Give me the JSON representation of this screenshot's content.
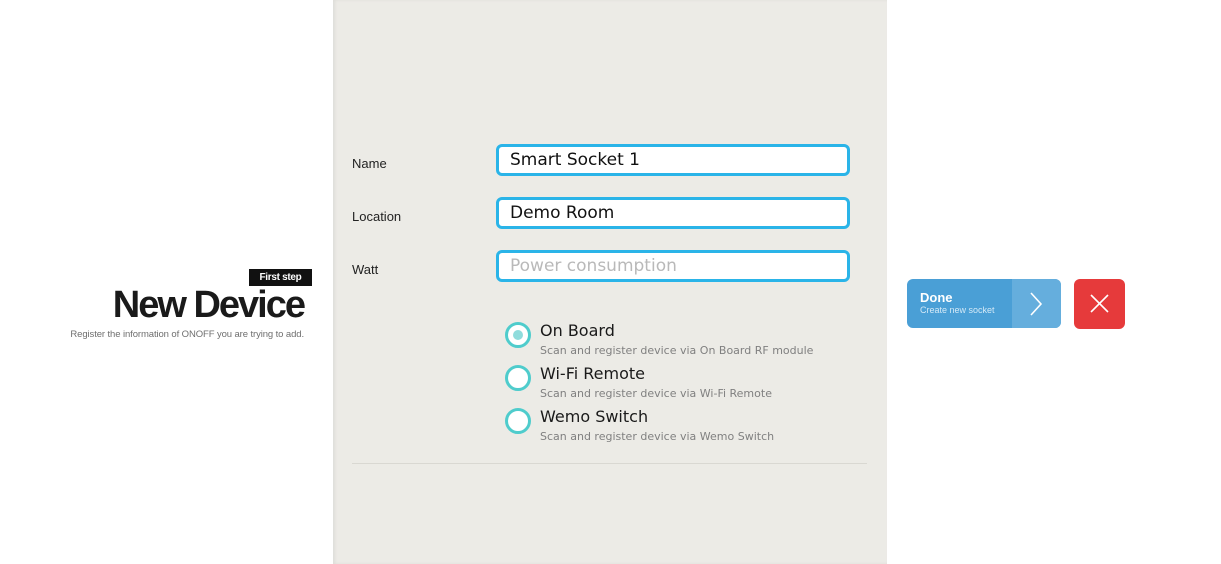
{
  "header": {
    "step_badge": "First step",
    "title": "New Device",
    "subtitle": "Register the information of ONOFF you are trying to add."
  },
  "form": {
    "fields": [
      {
        "label": "Name",
        "value": "Smart Socket 1",
        "placeholder": ""
      },
      {
        "label": "Location",
        "value": "Demo Room",
        "placeholder": ""
      },
      {
        "label": "Watt",
        "value": "",
        "placeholder": "Power consumption"
      }
    ],
    "options": [
      {
        "title": "On Board",
        "description": "Scan and register device via On Board RF module",
        "selected": true
      },
      {
        "title": "Wi-Fi Remote",
        "description": "Scan and register device via Wi-Fi Remote",
        "selected": false
      },
      {
        "title": "Wemo Switch",
        "description": "Scan and register device via Wemo Switch",
        "selected": false
      }
    ]
  },
  "actions": {
    "done_label": "Done",
    "done_sublabel": "Create new socket",
    "done_icon": "chevron-right-icon",
    "close_icon": "close-icon"
  },
  "colors": {
    "input_border": "#2ab4e8",
    "radio": "#4fcccc",
    "done": "#4a9fd6",
    "close": "#e63a3b",
    "panel": "#ecebe6"
  }
}
